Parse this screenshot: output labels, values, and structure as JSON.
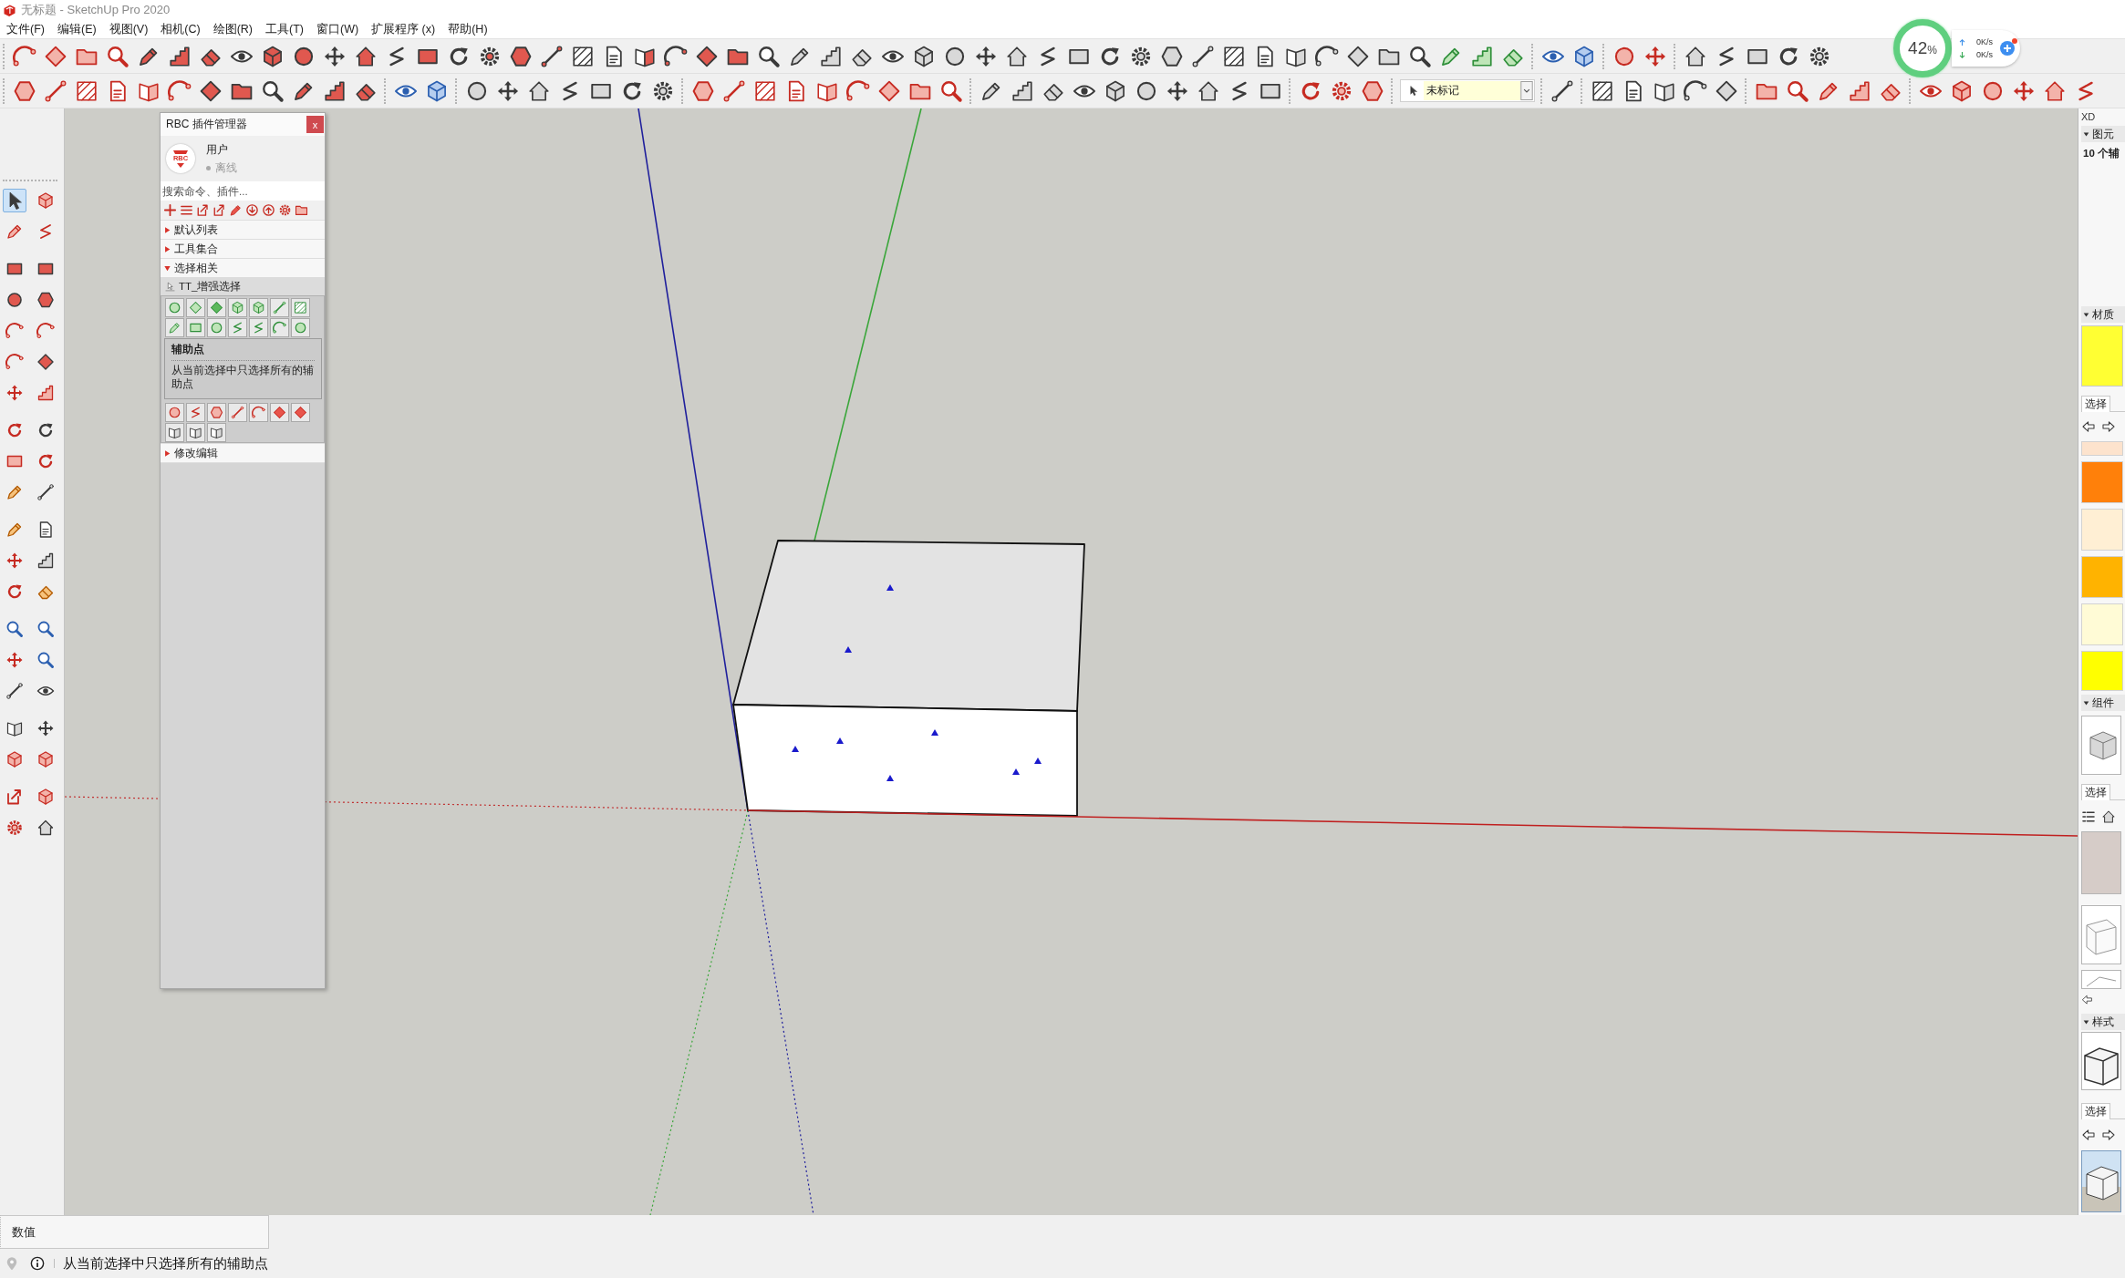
{
  "window": {
    "title": "无标题 - SketchUp Pro 2020"
  },
  "menu": [
    "文件(F)",
    "编辑(E)",
    "视图(V)",
    "相机(C)",
    "绘图(R)",
    "工具(T)",
    "窗口(W)",
    "扩展程序 (x)",
    "帮助(H)"
  ],
  "toolbar": {
    "tag_dropdown": {
      "value": "未标记"
    }
  },
  "net_monitor": {
    "percent": "42",
    "unit": "%",
    "upload": "0K/s",
    "download": "0K/s",
    "notification": true
  },
  "left_toolbar": {
    "tools": [
      {
        "selected": true
      },
      {
        "selected": false
      },
      {
        "selected": false
      },
      {
        "selected": false
      },
      {
        "selected": false
      },
      {
        "selected": false
      },
      {
        "selected": false
      },
      {
        "selected": false
      },
      {
        "selected": false
      },
      {
        "selected": false
      },
      {
        "selected": false
      },
      {
        "selected": false
      },
      {
        "selected": false
      },
      {
        "selected": false
      },
      {
        "selected": false
      },
      {
        "selected": false
      },
      {
        "selected": false
      },
      {
        "selected": false
      },
      {
        "selected": false
      },
      {
        "selected": false
      },
      {
        "selected": false
      },
      {
        "selected": false
      },
      {
        "selected": false
      },
      {
        "selected": false
      },
      {
        "selected": false
      },
      {
        "selected": false
      },
      {
        "selected": false
      },
      {
        "selected": false
      },
      {
        "selected": false
      },
      {
        "selected": false
      },
      {
        "selected": false
      },
      {
        "selected": false
      },
      {
        "selected": false
      },
      {
        "selected": false
      },
      {
        "selected": false
      },
      {
        "selected": false
      },
      {
        "selected": false
      },
      {
        "selected": false
      },
      {
        "selected": false
      },
      {
        "selected": false
      }
    ]
  },
  "plugin_panel": {
    "title": "RBC 插件管理器",
    "close": "x",
    "user": {
      "logo": "RBC",
      "name": "用户",
      "status": "离线",
      "online": false
    },
    "search": {
      "placeholder": "搜索命令、插件..."
    },
    "categories": [
      {
        "label": "默认列表",
        "expanded": false
      },
      {
        "label": "工具集合",
        "expanded": false
      },
      {
        "label": "选择相关",
        "expanded": true,
        "children": [
          {
            "label": "TT_增强选择"
          }
        ]
      },
      {
        "label": "修改编辑",
        "expanded": false
      }
    ],
    "tooltip": {
      "title": "辅助点",
      "text": "从当前选择中只选择所有的辅助点"
    }
  },
  "tray": {
    "title": "XD",
    "sections": [
      {
        "kind": "entity",
        "title": "图元",
        "expanded": true,
        "summary": "10 个辅"
      },
      {
        "kind": "materials",
        "title": "材质",
        "expanded": true,
        "preview": {
          "color": "#ffff33"
        },
        "tabs": [
          {
            "label": "选择",
            "selected": true
          }
        ],
        "swatches": [
          {
            "color": "#fde3cd"
          },
          {
            "color": "#ff800a"
          },
          {
            "color": "#ffefd4"
          },
          {
            "color": "#ffb300"
          },
          {
            "color": "#fffbd6"
          },
          {
            "color": "#ffff00"
          }
        ]
      },
      {
        "kind": "components",
        "title": "组件",
        "expanded": true,
        "tabs": [
          {
            "label": "选择",
            "selected": true
          }
        ]
      },
      {
        "kind": "styles",
        "title": "样式",
        "expanded": true,
        "tabs": [
          {
            "label": "选择",
            "selected": true
          }
        ]
      }
    ]
  },
  "status_bar": {
    "measurement_label": "数值",
    "message": "从当前选择中只选择所有的辅助点"
  }
}
